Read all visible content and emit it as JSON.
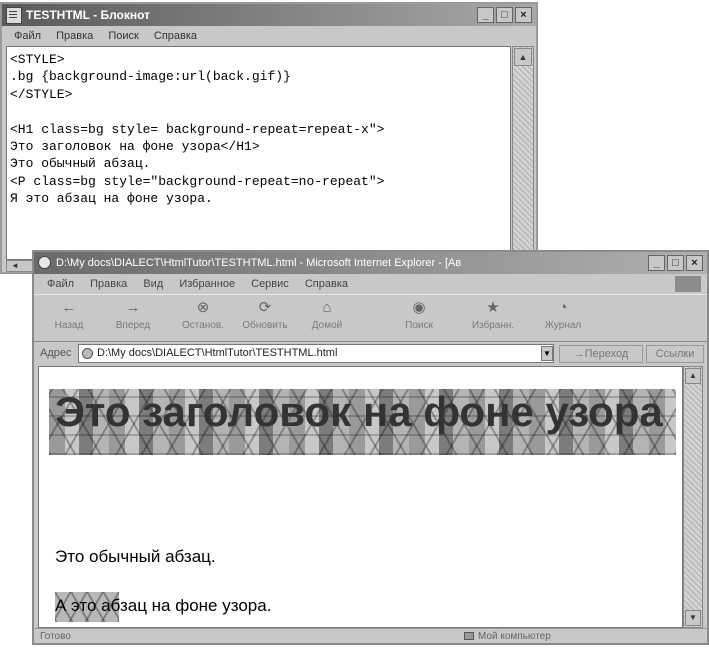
{
  "notepad": {
    "title": "TESTHTML - Блокнот",
    "menu": [
      "Файл",
      "Правка",
      "Поиск",
      "Справка"
    ],
    "text_lines": [
      "<STYLE>",
      ".bg {background-image:url(back.gif)}",
      "</STYLE>",
      "",
      "<H1 class=bg style= background-repeat=repeat-x\">",
      "Это заголовок на фоне узора</H1>",
      "Это обычный абзац.",
      "<P class=bg style=\"background-repeat=no-repeat\">",
      "Я это абзац на фоне узора."
    ]
  },
  "ie": {
    "title": "D:\\My docs\\DIALECT\\HtmlTutor\\TESTHTML.html - Microsoft Internet Explorer - [Ав",
    "menu": [
      "Файл",
      "Правка",
      "Вид",
      "Избранное",
      "Сервис",
      "Справка"
    ],
    "toolbar": [
      {
        "label": "Назад",
        "icon": "back-arrow-icon",
        "glyph": "←"
      },
      {
        "label": "Вперед",
        "icon": "forward-arrow-icon",
        "glyph": "→"
      },
      {
        "label": "Останов.",
        "icon": "stop-icon",
        "glyph": "⊗"
      },
      {
        "label": "Обновить",
        "icon": "refresh-icon",
        "glyph": "⟳"
      },
      {
        "label": "Домой",
        "icon": "home-icon",
        "glyph": "⌂"
      },
      {
        "label": "Поиск",
        "icon": "search-icon",
        "glyph": "◉"
      },
      {
        "label": "Избранн.",
        "icon": "favorites-icon",
        "glyph": "★"
      },
      {
        "label": "Журнал",
        "icon": "history-icon",
        "glyph": "◔"
      }
    ],
    "address": {
      "label": "Адрес",
      "value": "D:\\My docs\\DIALECT\\HtmlTutor\\TESTHTML.html",
      "go_label": "Переход",
      "links_label": "Ссылки"
    },
    "content": {
      "heading": "Это заголовок на фоне узора",
      "para1": "Это обычный абзац.",
      "para2": "А это абзац на фоне узора."
    },
    "status": {
      "left": "Готово",
      "zone": "Мой компьютер"
    }
  }
}
